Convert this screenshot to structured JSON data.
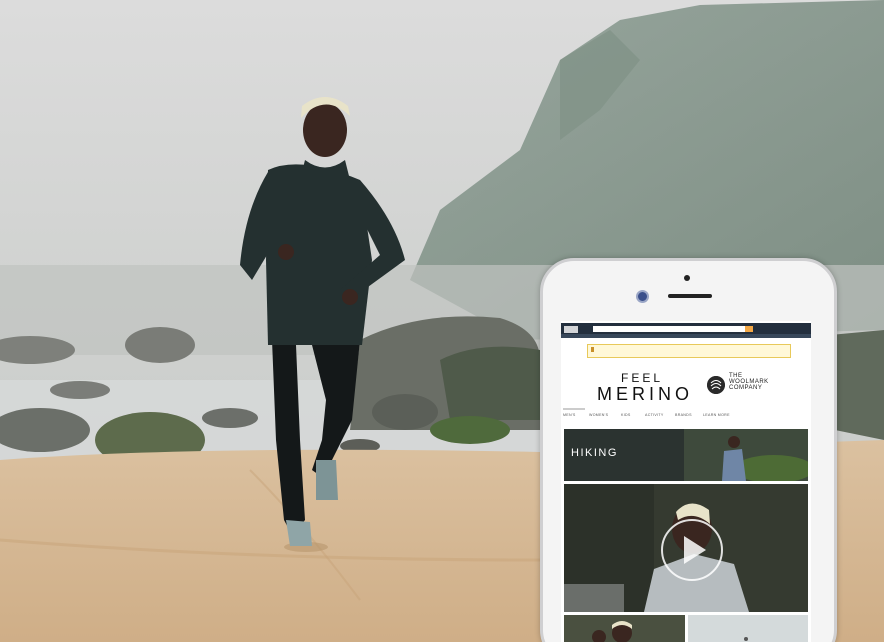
{
  "phone": {
    "brand_line1": "FEEL",
    "brand_line2": "MERINO",
    "partner_line1": "THE",
    "partner_line2": "WOOLMARK",
    "partner_line3": "COMPANY",
    "nav_items": [
      "MEN'S",
      "WOMEN'S",
      "KIDS",
      "ACTIVITY",
      "BRANDS",
      "LEARN MORE"
    ],
    "hiking_label": "HIKING"
  },
  "colors": {
    "sand": "#d6b893",
    "fog": "#c7c8c6",
    "jacket": "#1f2a2a",
    "topbar": "#232f3e"
  }
}
